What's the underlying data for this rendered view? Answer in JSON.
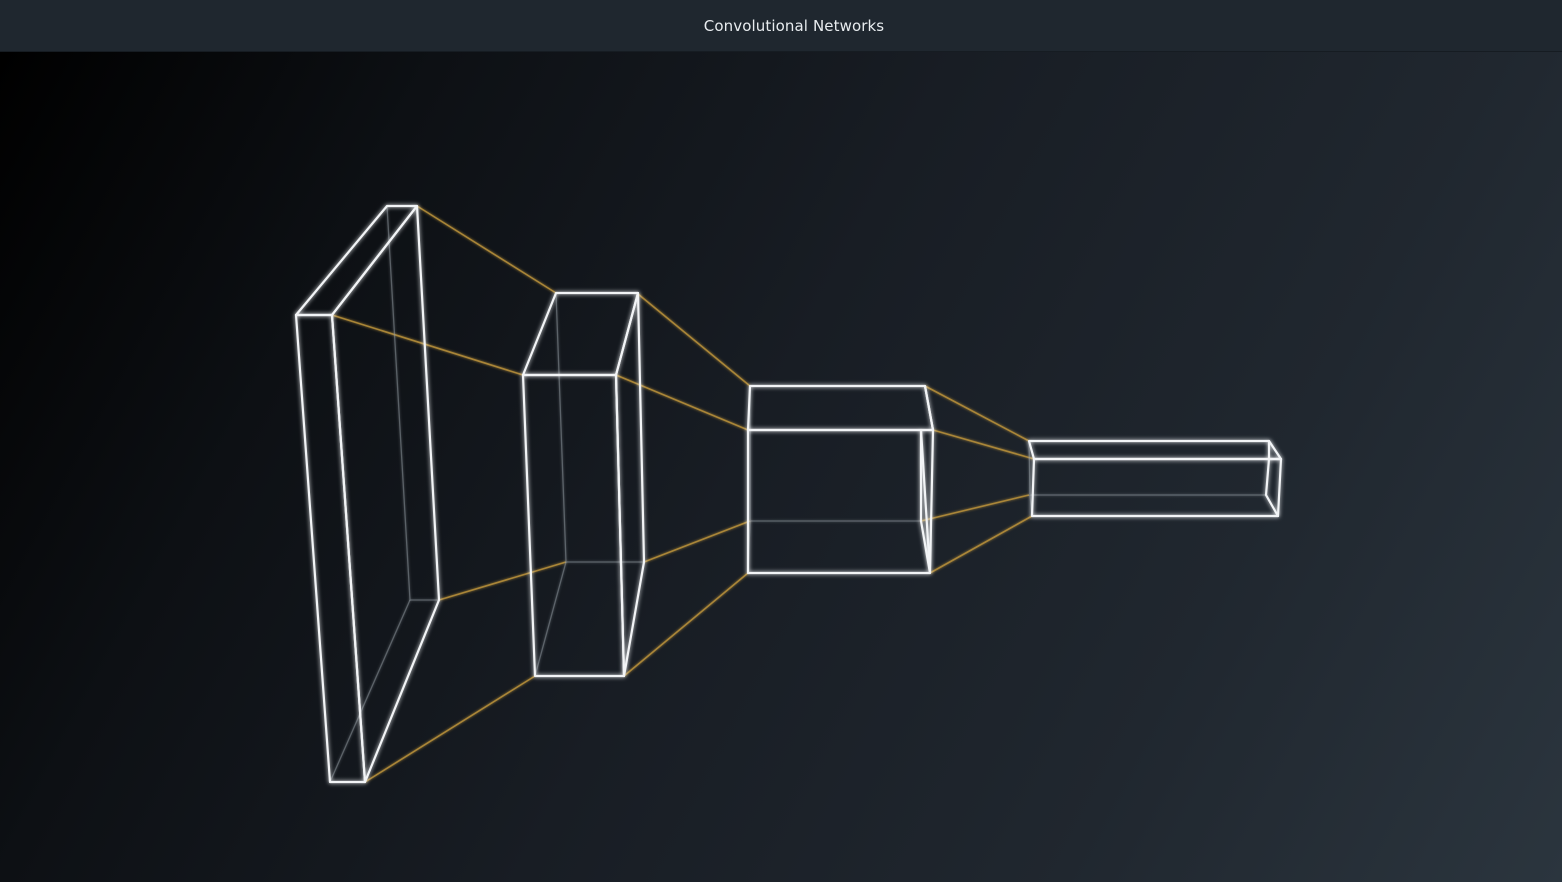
{
  "window": {
    "title": "Convolutional Networks"
  },
  "diagram": {
    "layers": [
      "layer-1",
      "layer-2",
      "layer-3",
      "layer-4"
    ],
    "colors": {
      "edge": "#f2f4f6",
      "hidden_edge": "#9aa1a8",
      "connector": "#b8913a",
      "titlebar": "#1f272f"
    }
  }
}
